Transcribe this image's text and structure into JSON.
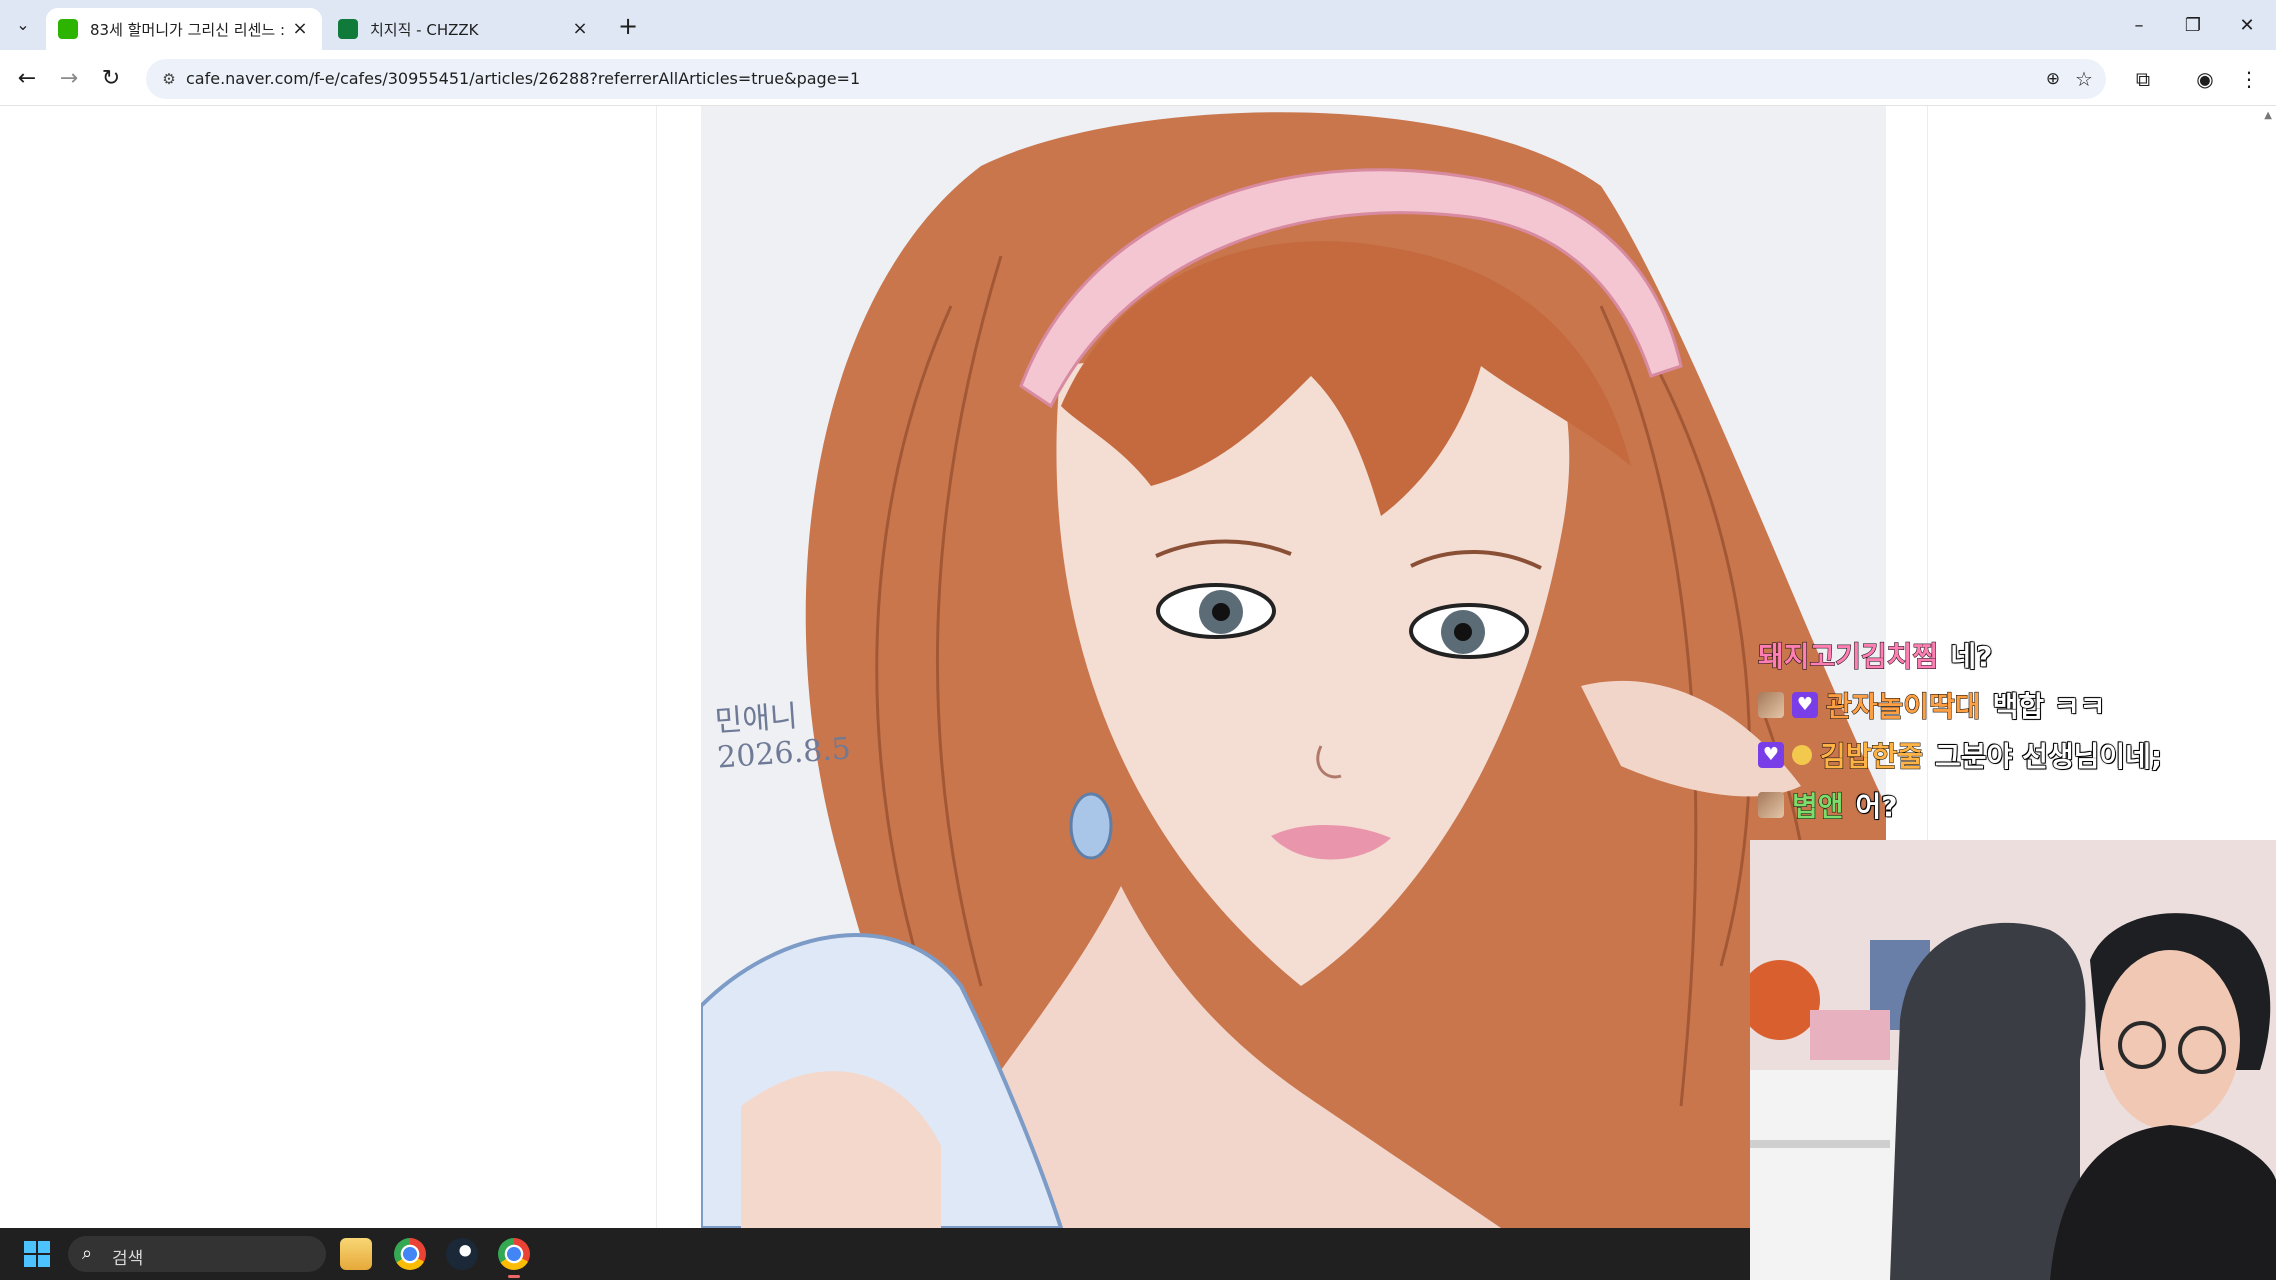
{
  "browser": {
    "tabs": [
      {
        "title": "83세 할머니가 그리신 리센느 :",
        "active": true,
        "favicon": "naver-cafe-icon",
        "favicon_color": "#2db400"
      },
      {
        "title": "치지직 - CHZZK",
        "active": false,
        "favicon": "chzzk-icon",
        "favicon_color": "#0f7a3a"
      }
    ],
    "tab_list_icon": "chevron-down-icon",
    "new_tab_icon": "plus-icon",
    "url": "cafe.naver.com/f-e/cafes/30955451/articles/26288?referrerAllArticles=true&page=1",
    "window_controls": [
      "minimize-icon",
      "restore-icon",
      "close-icon"
    ],
    "toolbar_icons": [
      "back-arrow-icon",
      "forward-arrow-icon",
      "reload-icon",
      "site-settings-icon",
      "zoom-icon",
      "bookmark-star-icon",
      "extensions-icon",
      "profile-icon",
      "kebab-menu-icon"
    ]
  },
  "artwork": {
    "signature_name": "민애니",
    "signature_date": "2026.8.5"
  },
  "chat": [
    {
      "user": "돼지고기김치찜",
      "user_color": "#ff7eb3",
      "message": "네?",
      "badges": []
    },
    {
      "user": "관자놀이딱대",
      "user_color": "#ff9f43",
      "message": "백합 ㅋㅋ",
      "badges": [
        "image-badge",
        "heart-badge"
      ]
    },
    {
      "user": "김밥한줄",
      "user_color": "#ffb347",
      "message": "그분야 선생님이네;",
      "badges": [
        "heart-badge",
        "star-badge"
      ]
    },
    {
      "user": "볍앤",
      "user_color": "#7ddc6b",
      "message": "어?",
      "badges": [
        "image-badge"
      ]
    }
  ],
  "taskbar": {
    "search_placeholder": "검색",
    "apps": [
      "file-explorer-icon",
      "chrome-icon",
      "steam-icon",
      "chrome-active-icon"
    ]
  },
  "colors": {
    "tabbar_bg": "#dfe7f5",
    "omnibox_bg": "#edf2fa",
    "taskbar_bg": "#202020",
    "hair": "#c96b3f",
    "headband": "#f4c6d2"
  }
}
